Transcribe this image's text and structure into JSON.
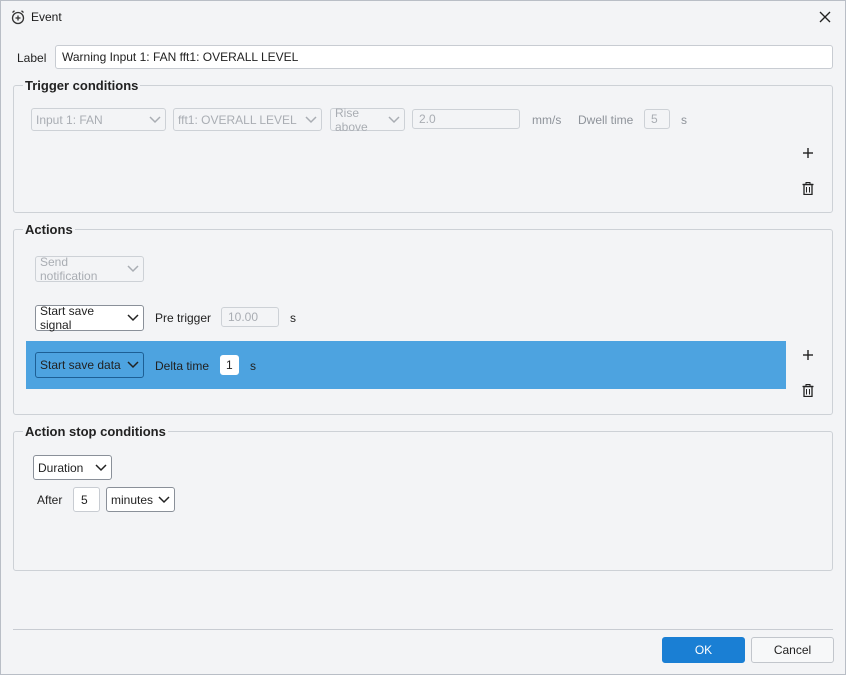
{
  "window": {
    "title": "Event",
    "icon": "alarm-clock-plus-icon"
  },
  "label_field": {
    "label": "Label",
    "value": "Warning Input 1: FAN fft1: OVERALL LEVEL"
  },
  "trigger_conditions": {
    "title": "Trigger conditions",
    "input_select": "Input 1: FAN",
    "measure_select": "fft1: OVERALL LEVEL",
    "condition_select": "Rise above",
    "threshold_value": "2.0",
    "threshold_unit": "mm/s",
    "dwell_label": "Dwell time",
    "dwell_value": "5",
    "dwell_unit": "s"
  },
  "actions": {
    "title": "Actions",
    "notification_select": "Send notification",
    "save_signal": {
      "select": "Start save signal",
      "pretrigger_label": "Pre trigger",
      "pretrigger_value": "10.00",
      "unit": "s"
    },
    "save_data": {
      "select": "Start save data",
      "delta_label": "Delta time",
      "delta_value": "1",
      "unit": "s"
    }
  },
  "stop_conditions": {
    "title": "Action stop conditions",
    "type_select": "Duration",
    "after_label": "After",
    "after_value": "5",
    "unit_select": "minutes"
  },
  "buttons": {
    "ok": "OK",
    "cancel": "Cancel"
  },
  "colors": {
    "accent": "#1a7fd4",
    "highlight": "#4da3e0"
  }
}
